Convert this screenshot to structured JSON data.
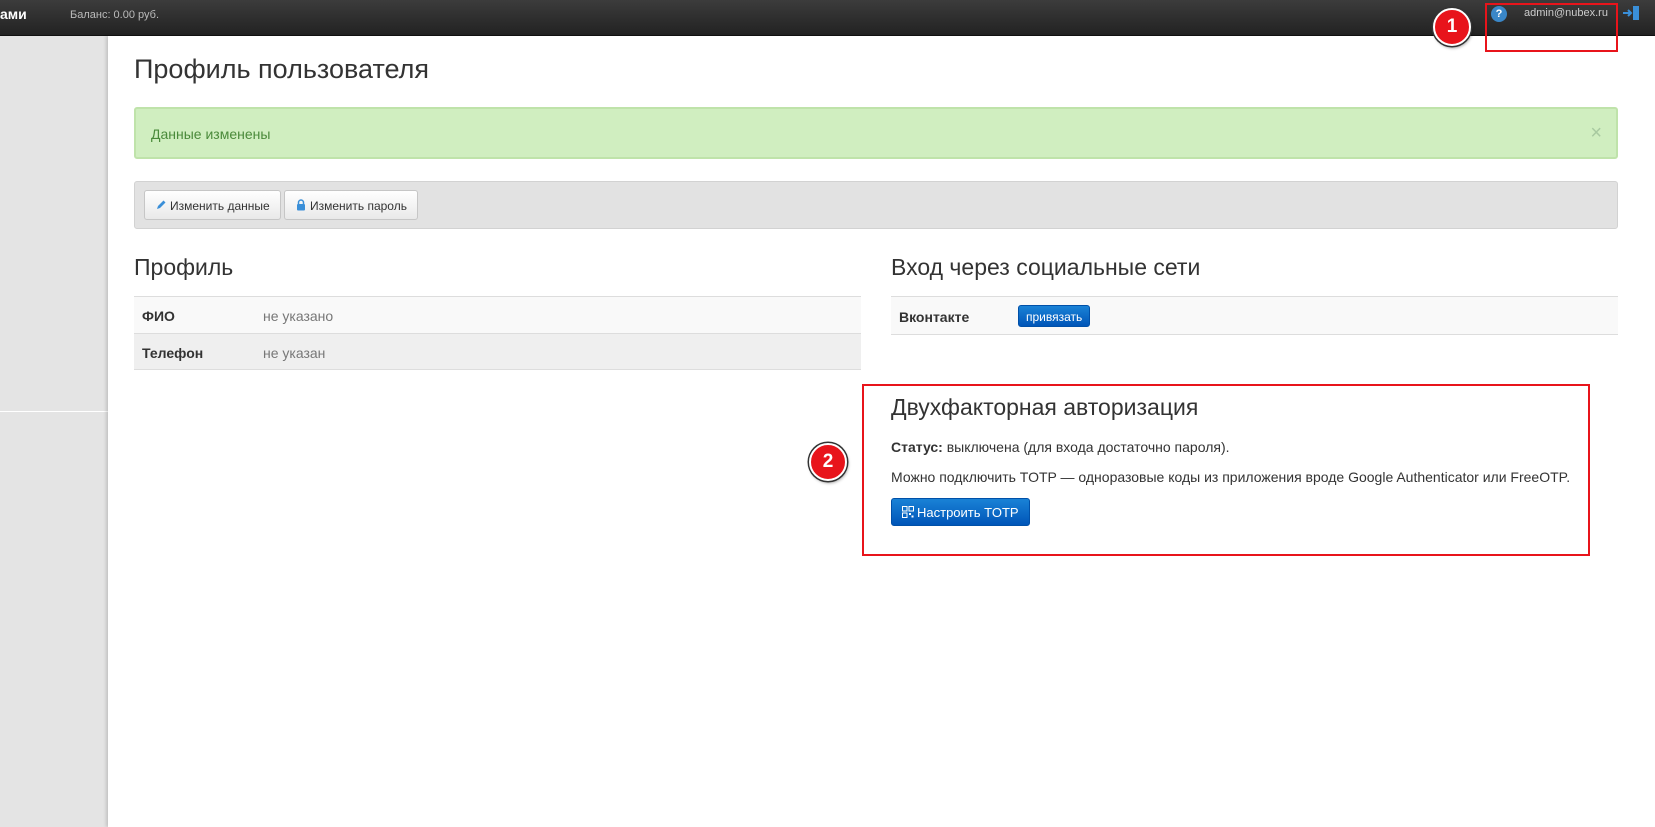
{
  "navbar": {
    "brand": "ами",
    "balance": "Баланс: 0.00 руб.",
    "help_icon": "question-circle-icon",
    "user_email": "admin@nubex.ru",
    "logout_icon": "logout-icon"
  },
  "page": {
    "title": "Профиль пользователя"
  },
  "alert": {
    "text": "Данные изменены",
    "close": "×"
  },
  "toolbar": {
    "edit_label": "Изменить данные",
    "edit_icon": "pencil-icon",
    "password_label": "Изменить пароль",
    "password_icon": "lock-icon"
  },
  "profile": {
    "title": "Профиль",
    "rows": [
      {
        "key": "ФИО",
        "value": "не указано"
      },
      {
        "key": "Телефон",
        "value": "не указан"
      }
    ]
  },
  "social": {
    "title": "Вход через социальные сети",
    "rows": [
      {
        "key": "Вконтакте",
        "action": "привязать"
      }
    ]
  },
  "two_factor": {
    "title": "Двухфакторная авторизация",
    "status_label": "Статус:",
    "status_value": " выключена (для входа достаточно пароля).",
    "description": "Можно подключить TOTP — одноразовые коды из приложения вроде Google Authenticator или FreeOTP.",
    "button_label": "Настроить TOTP",
    "button_icon": "qr-code-icon"
  },
  "annotations": {
    "marker_1": "1",
    "marker_2": "2",
    "color": "#e8141b"
  },
  "colors": {
    "alert_bg": "#d0eec0",
    "alert_text": "#4a8a3a",
    "primary_button": "#0a6cc8"
  }
}
